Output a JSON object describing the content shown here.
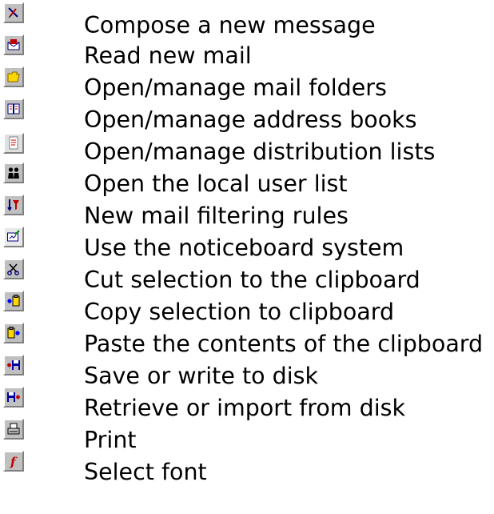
{
  "legend": {
    "items": [
      {
        "icon": "compose-icon",
        "label": "Compose a new message"
      },
      {
        "icon": "read-mail-icon",
        "label": "Read new mail"
      },
      {
        "icon": "folder-icon",
        "label": "Open/manage mail folders"
      },
      {
        "icon": "address-book-icon",
        "label": "Open/manage address books"
      },
      {
        "icon": "distribution-list-icon",
        "label": "Open/manage distribution lists"
      },
      {
        "icon": "user-list-icon",
        "label": "Open the local user list"
      },
      {
        "icon": "filter-rules-icon",
        "label": "New mail filtering rules"
      },
      {
        "icon": "noticeboard-icon",
        "label": "Use the noticeboard system"
      },
      {
        "icon": "cut-icon",
        "label": "Cut selection to the clipboard"
      },
      {
        "icon": "copy-icon",
        "label": "Copy selection to clipboard"
      },
      {
        "icon": "paste-icon",
        "label": "Paste the contents of the clipboard"
      },
      {
        "icon": "save-icon",
        "label": "Save or write to disk"
      },
      {
        "icon": "retrieve-icon",
        "label": "Retrieve or import from disk"
      },
      {
        "icon": "print-icon",
        "label": "Print"
      },
      {
        "icon": "font-icon",
        "label": "Select font"
      }
    ]
  }
}
